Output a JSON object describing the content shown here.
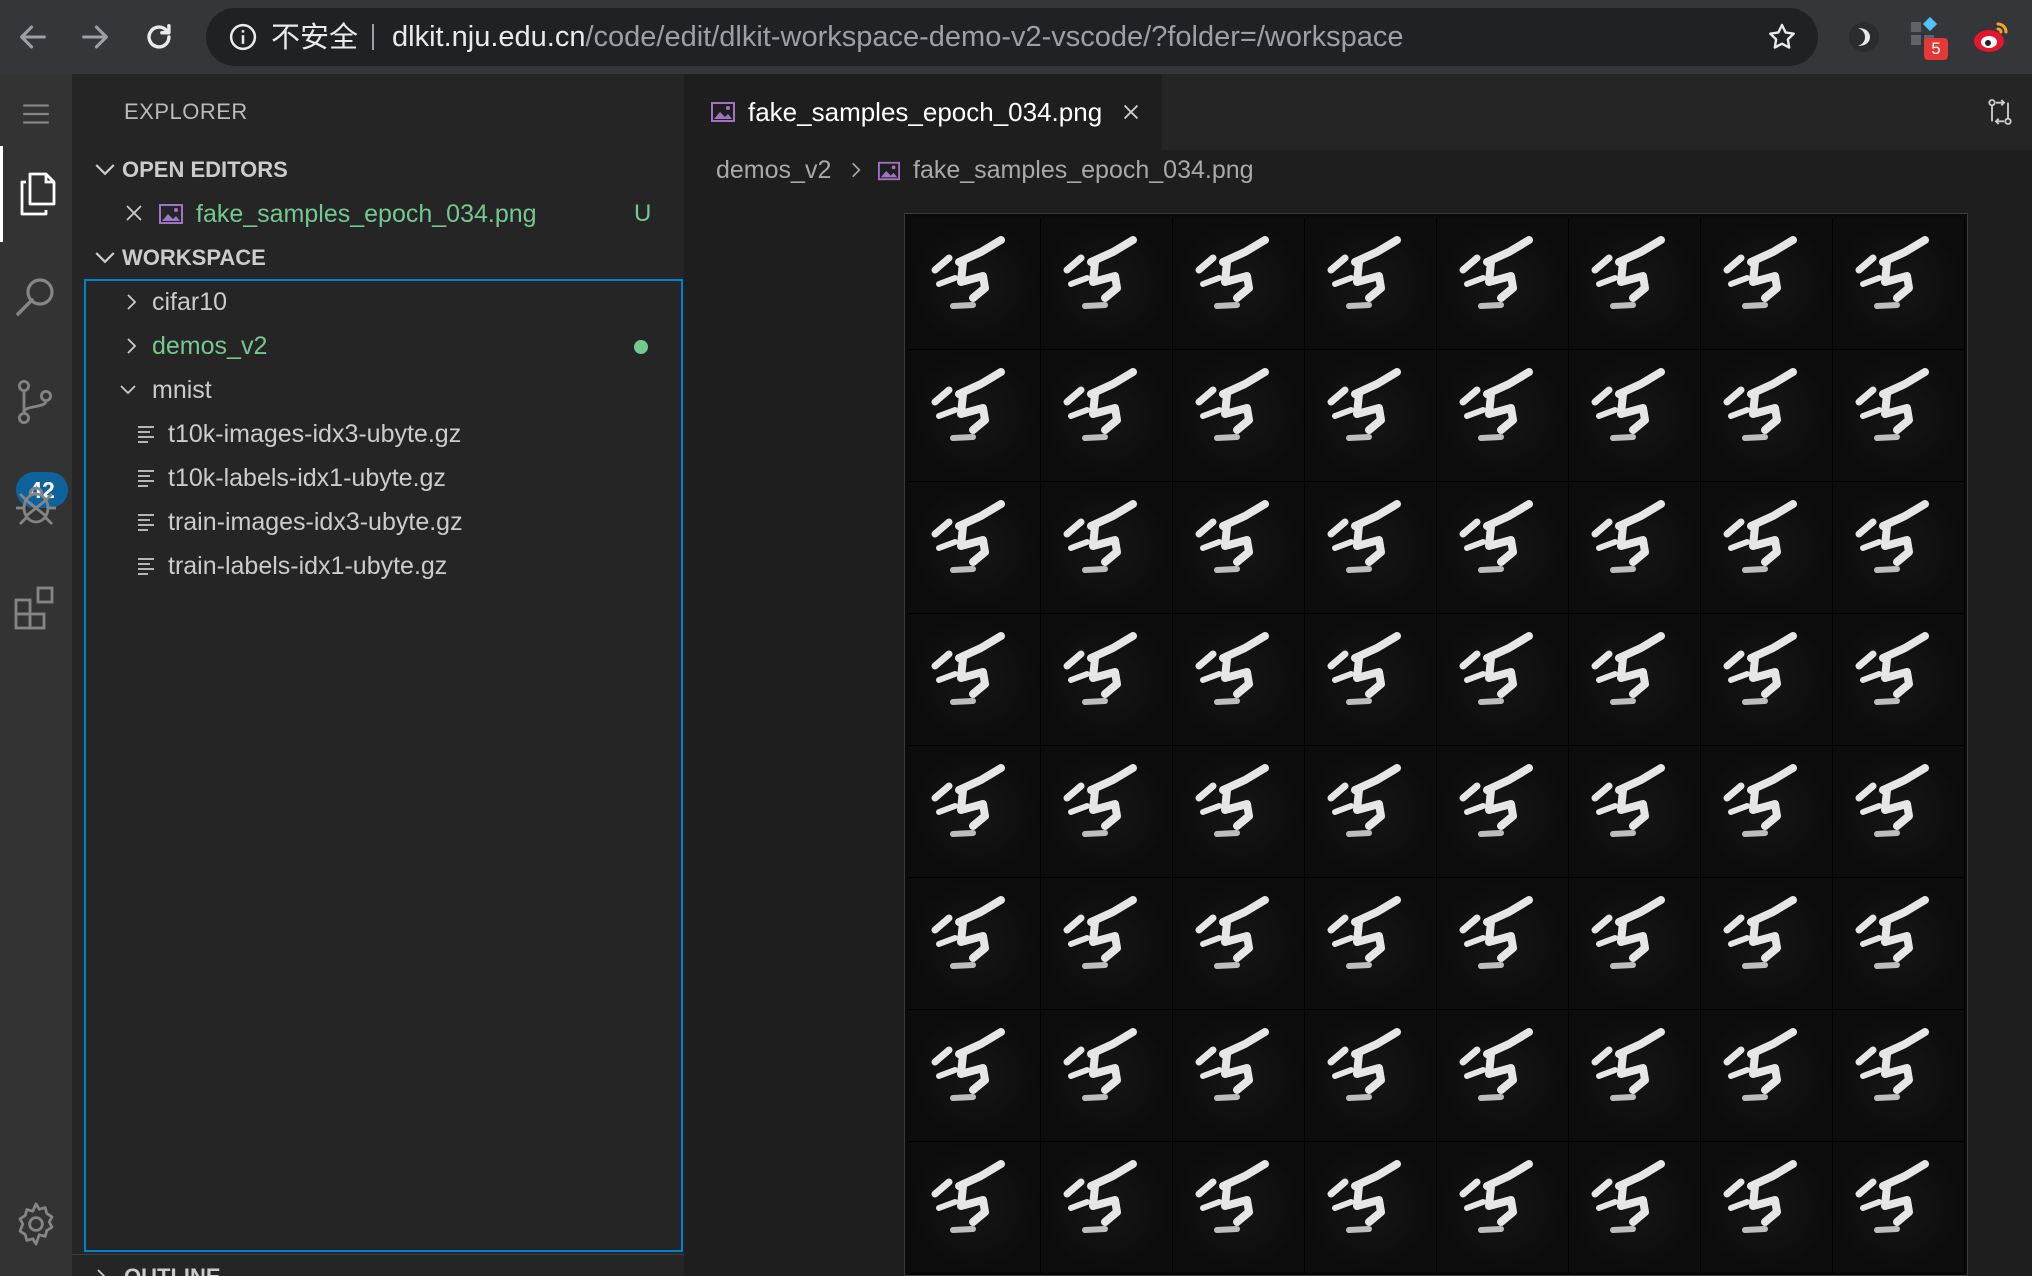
{
  "browser": {
    "insecure_label": "不安全",
    "url_host": "dlkit.nju.edu.cn",
    "url_path": "/code/edit/dlkit-workspace-demo-v2-vscode/?folder=/workspace",
    "extension_badge": "5",
    "icons": [
      "back-arrow-icon",
      "forward-arrow-icon",
      "reload-icon",
      "info-icon",
      "star-icon",
      "extension-icon",
      "extension-grid-icon",
      "weibo-icon"
    ]
  },
  "activity_bar": {
    "scm_badge": "42",
    "items": [
      "menu-icon",
      "files-icon",
      "search-icon",
      "source-control-icon",
      "debug-icon",
      "extensions-icon",
      "settings-gear-icon"
    ]
  },
  "sidebar": {
    "title": "EXPLORER",
    "open_editors": {
      "header": "OPEN EDITORS",
      "items": [
        {
          "name": "fake_samples_epoch_034.png",
          "status": "U"
        }
      ]
    },
    "workspace": {
      "header": "WORKSPACE",
      "tree": [
        {
          "label": "cifar10",
          "type": "folder",
          "expanded": false
        },
        {
          "label": "demos_v2",
          "type": "folder",
          "expanded": false,
          "modified": true
        },
        {
          "label": "mnist",
          "type": "folder",
          "expanded": true
        },
        {
          "label": "t10k-images-idx3-ubyte.gz",
          "type": "file"
        },
        {
          "label": "t10k-labels-idx1-ubyte.gz",
          "type": "file"
        },
        {
          "label": "train-images-idx3-ubyte.gz",
          "type": "file"
        },
        {
          "label": "train-labels-idx1-ubyte.gz",
          "type": "file"
        }
      ]
    },
    "outline": {
      "header": "OUTLINE"
    }
  },
  "editor": {
    "tab_label": "fake_samples_epoch_034.png",
    "breadcrumb": {
      "root": "demos_v2",
      "file": "fake_samples_epoch_034.png"
    },
    "preview": {
      "rows": 8,
      "cols": 8
    }
  },
  "colors": {
    "accent": "#007fd4",
    "untracked_green": "#73c991",
    "badge_blue": "#0e639c",
    "activity_bg": "#333333",
    "sidebar_bg": "#252526",
    "editor_bg": "#1e1e1e"
  }
}
